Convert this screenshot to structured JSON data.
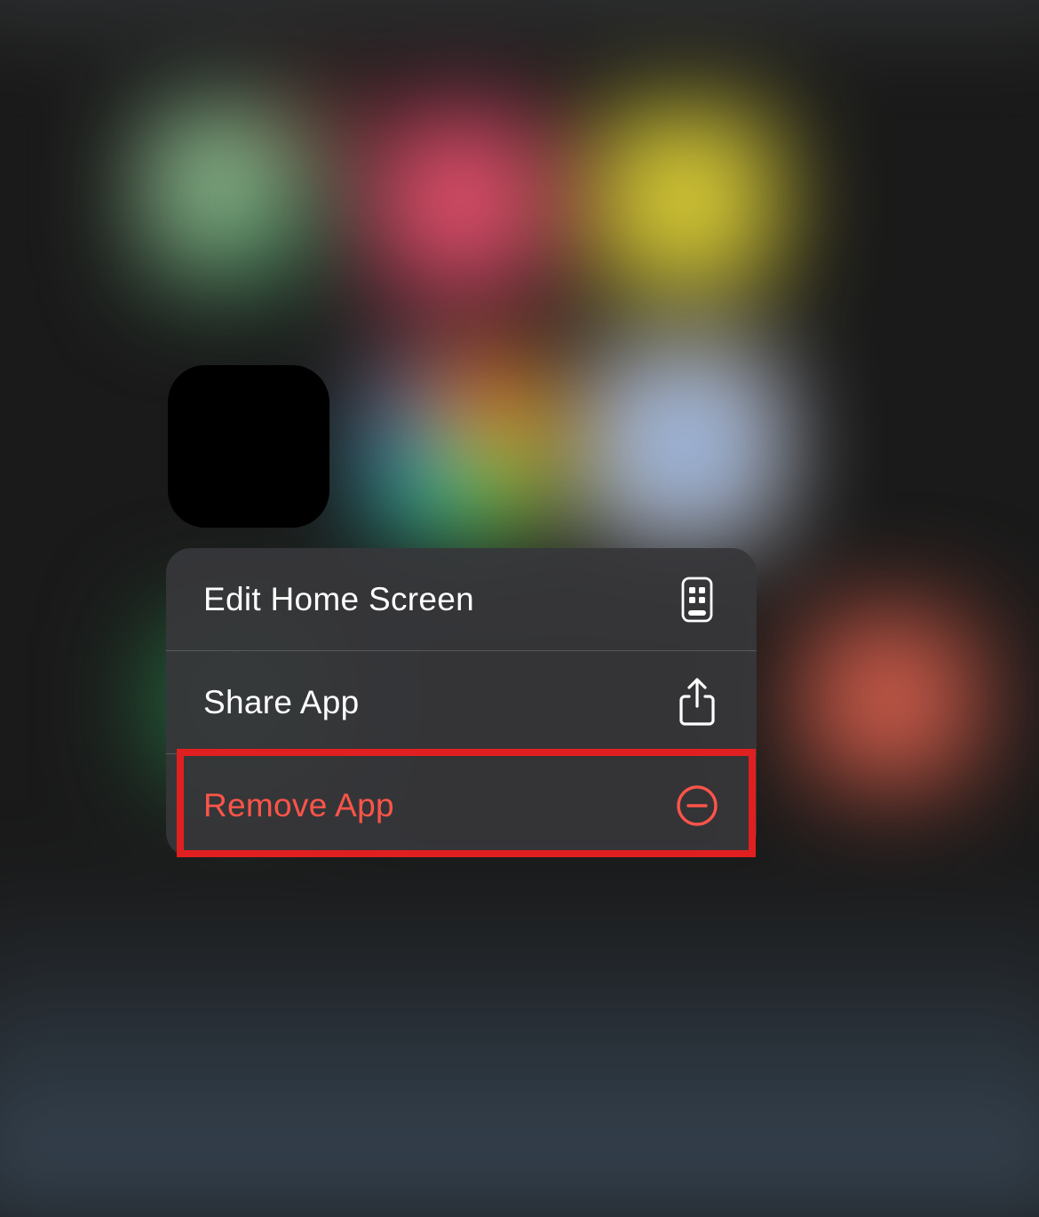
{
  "context_menu": {
    "items": [
      {
        "label": "Edit Home Screen",
        "icon": "home-screen-edit-icon",
        "destructive": false
      },
      {
        "label": "Share App",
        "icon": "share-icon",
        "destructive": false
      },
      {
        "label": "Remove App",
        "icon": "minus-circle-icon",
        "destructive": true
      }
    ]
  },
  "highlighted_item_index": 2
}
